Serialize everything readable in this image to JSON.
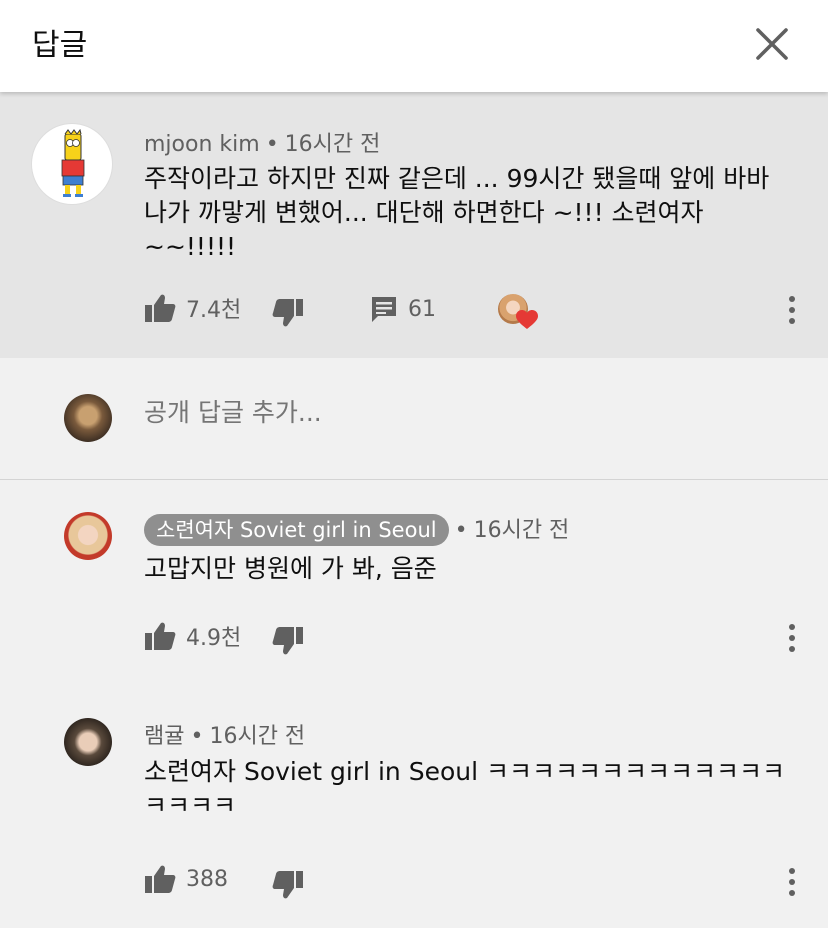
{
  "header": {
    "title": "답글",
    "close_icon": "close-icon"
  },
  "main_comment": {
    "author": "mjoon kim",
    "time": "16시간 전",
    "text_lines": [
      "주작이라고 하지만 진짜 같은데 ... 99시간 됐을때 앞에 바바",
      "나가 까맣게 변했어... 대단해  하면한다 ~!!!  소련여자",
      "~~!!!!!"
    ],
    "likes": "7.4천",
    "replies": "61"
  },
  "reply_box": {
    "placeholder": "공개 답글 추가..."
  },
  "replies": [
    {
      "author": "소련여자 Soviet girl in Seoul",
      "time": "16시간 전",
      "text_lines": [
        "고맙지만 병원에 가 봐, 음준"
      ],
      "likes": "4.9천"
    },
    {
      "author": "램귤",
      "time": "16시간 전",
      "text_lines": [
        "소련여자 Soviet girl in Seoul ㅋㅋㅋㅋㅋㅋㅋㅋㅋㅋㅋㅋㅋ",
        "ㅋㅋㅋㅋ"
      ],
      "likes": "388"
    }
  ],
  "colors": {
    "main_bg": "#e5e5e5",
    "page_bg": "#f1f1f1",
    "badge_bg": "#8f8f8f",
    "heart": "#e53935"
  }
}
